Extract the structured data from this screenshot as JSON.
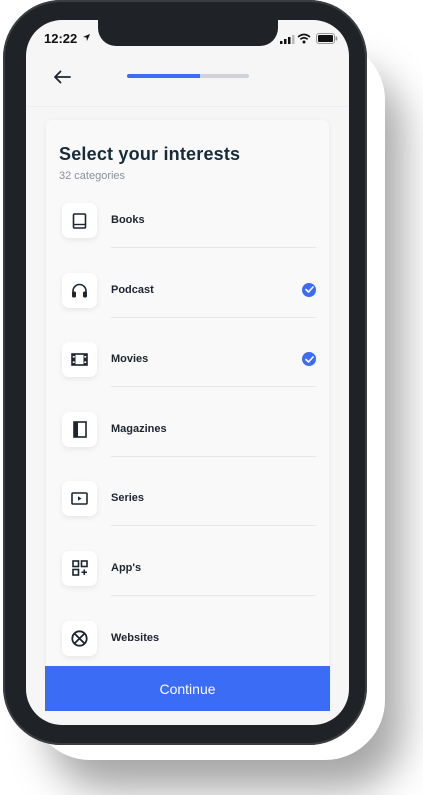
{
  "status": {
    "time": "12:22"
  },
  "header": {
    "progress_fraction": 0.6
  },
  "page": {
    "title": "Select your interests",
    "subtitle": "32 categories"
  },
  "categories": [
    {
      "label": "Books",
      "icon": "book-icon",
      "selected": false
    },
    {
      "label": "Podcast",
      "icon": "headphones-icon",
      "selected": true
    },
    {
      "label": "Movies",
      "icon": "film-icon",
      "selected": true
    },
    {
      "label": "Magazines",
      "icon": "magazine-icon",
      "selected": false
    },
    {
      "label": "Series",
      "icon": "play-box-icon",
      "selected": false
    },
    {
      "label": "App's",
      "icon": "apps-icon",
      "selected": false
    },
    {
      "label": "Websites",
      "icon": "web-icon",
      "selected": false
    }
  ],
  "footer": {
    "continue_label": "Continue"
  },
  "colors": {
    "accent": "#3b6cf6",
    "title": "#172b3a",
    "track": "#cfd2d6"
  }
}
